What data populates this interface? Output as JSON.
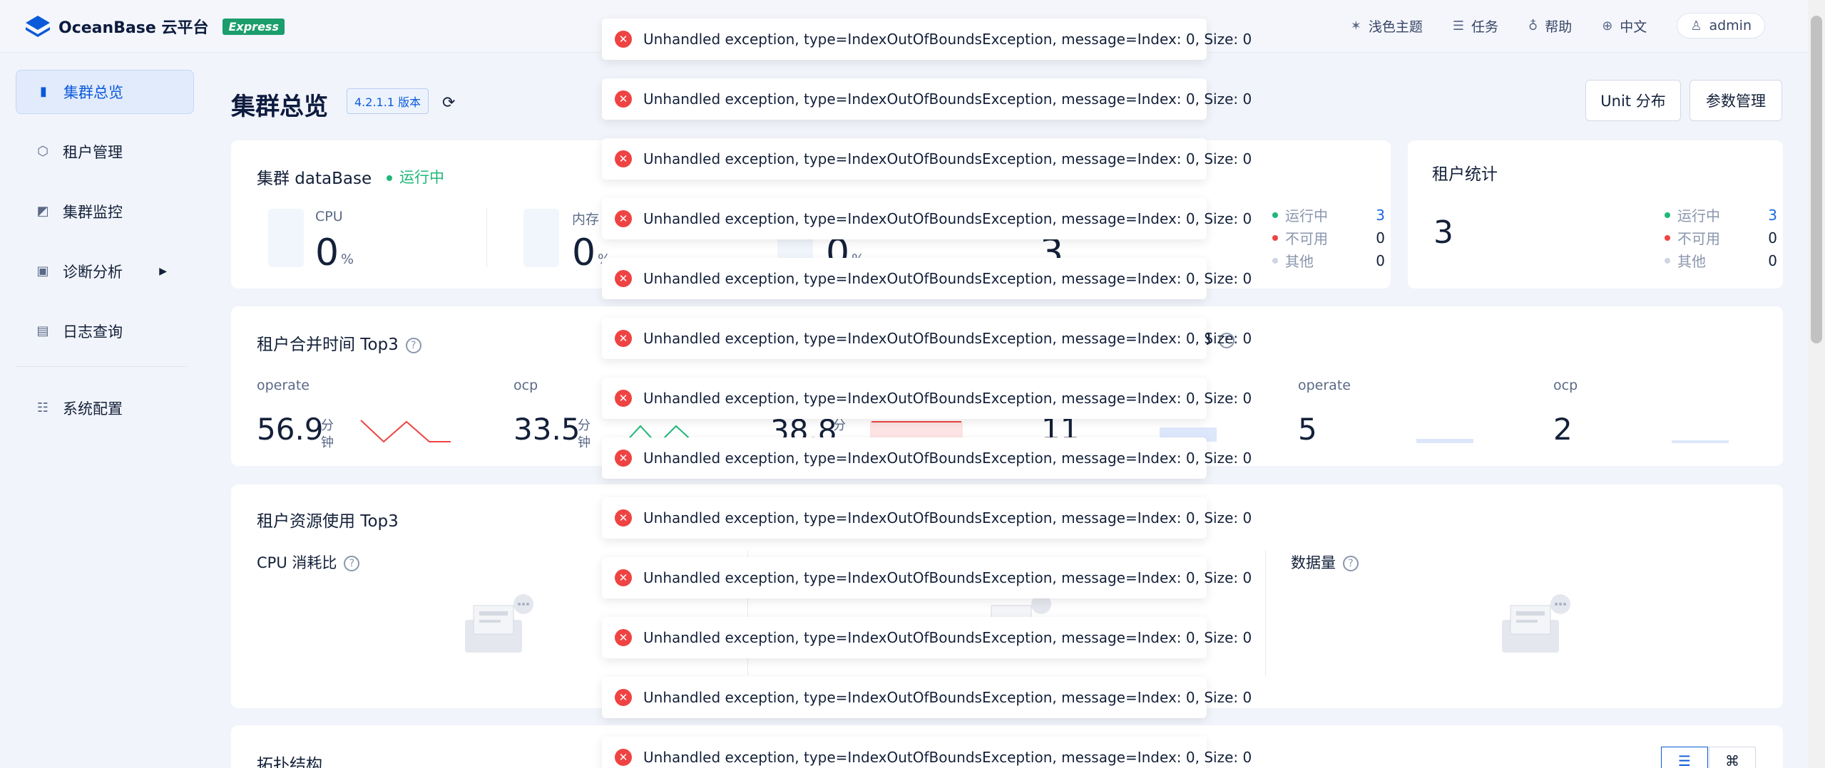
{
  "app": {
    "logo_text": "OceanBase 云平台",
    "logo_badge": "Express"
  },
  "topnav": {
    "theme": "浅色主题",
    "tasks": "任务",
    "help": "帮助",
    "language": "中文",
    "user": "admin"
  },
  "sidebar": {
    "items": [
      {
        "label": "集群总览",
        "icon": "bar-chart-icon",
        "active": true
      },
      {
        "label": "租户管理",
        "icon": "hexagon-icon"
      },
      {
        "label": "集群监控",
        "icon": "area-chart-icon"
      },
      {
        "label": "诊断分析",
        "icon": "diagnose-icon"
      },
      {
        "label": "日志查询",
        "icon": "document-icon"
      },
      {
        "label": "系统配置",
        "icon": "sliders-icon"
      }
    ]
  },
  "page": {
    "title": "集群总览",
    "version": "4.2.1.1 版本",
    "unit_button": "Unit 分布",
    "params_button": "参数管理"
  },
  "cluster_card": {
    "title": "集群 dataBase",
    "status": "运行中",
    "cpu_label": "CPU",
    "cpu_value": "0",
    "cpu_unit": "%",
    "mem_label": "内存",
    "mem_value": "0",
    "mem_unit": "%",
    "third_value": "0",
    "third_unit": "%",
    "fourth_value": "3",
    "legend": [
      {
        "label": "运行中",
        "value": "3"
      },
      {
        "label": "不可用",
        "value": "0"
      },
      {
        "label": "其他",
        "value": "0"
      }
    ]
  },
  "tenant_stats": {
    "title": "租户统计",
    "total": "3",
    "legend": [
      {
        "label": "运行中",
        "value": "3"
      },
      {
        "label": "不可用",
        "value": "0"
      },
      {
        "label": "其他",
        "value": "0"
      }
    ]
  },
  "merge_card": {
    "title": "租户合并时间 Top3",
    "title_suffix": "3",
    "items": [
      {
        "name": "operate",
        "value": "56.9",
        "unit": "分钟"
      },
      {
        "name": "ocp",
        "value": "33.5",
        "unit": "分钟"
      },
      {
        "value": "38.8",
        "unit": "分"
      },
      {
        "value": "11"
      },
      {
        "name": "operate",
        "value": "5"
      },
      {
        "name": "ocp",
        "value": "2"
      }
    ]
  },
  "resource_card": {
    "title": "租户资源使用 Top3",
    "cpu_label": "CPU 消耗比",
    "data_label": "数据量"
  },
  "topology": {
    "title": "拓扑结构"
  },
  "toasts": [
    "Unhandled exception, type=IndexOutOfBoundsException, message=Index: 0, Size: 0",
    "Unhandled exception, type=IndexOutOfBoundsException, message=Index: 0, Size: 0",
    "Unhandled exception, type=IndexOutOfBoundsException, message=Index: 0, Size: 0",
    "Unhandled exception, type=IndexOutOfBoundsException, message=Index: 0, Size: 0",
    "Unhandled exception, type=IndexOutOfBoundsException, message=Index: 0, Size: 0",
    "Unhandled exception, type=IndexOutOfBoundsException, message=Index: 0, Size: 0",
    "Unhandled exception, type=IndexOutOfBoundsException, message=Index: 0, Size: 0",
    "Unhandled exception, type=IndexOutOfBoundsException, message=Index: 0, Size: 0",
    "Unhandled exception, type=IndexOutOfBoundsException, message=Index: 0, Size: 0",
    "Unhandled exception, type=IndexOutOfBoundsException, message=Index: 0, Size: 0",
    "Unhandled exception, type=IndexOutOfBoundsException, message=Index: 0, Size: 0",
    "Unhandled exception, type=IndexOutOfBoundsException, message=Index: 0, Size: 0",
    "Unhandled exception, type=IndexOutOfBoundsException, message=Index: 0, Size: 0"
  ],
  "colors": {
    "primary": "#0b5ad9",
    "success": "#1fb778",
    "danger": "#ef4343",
    "trend_red": "#ef4343",
    "trend_green": "#1fb778"
  }
}
